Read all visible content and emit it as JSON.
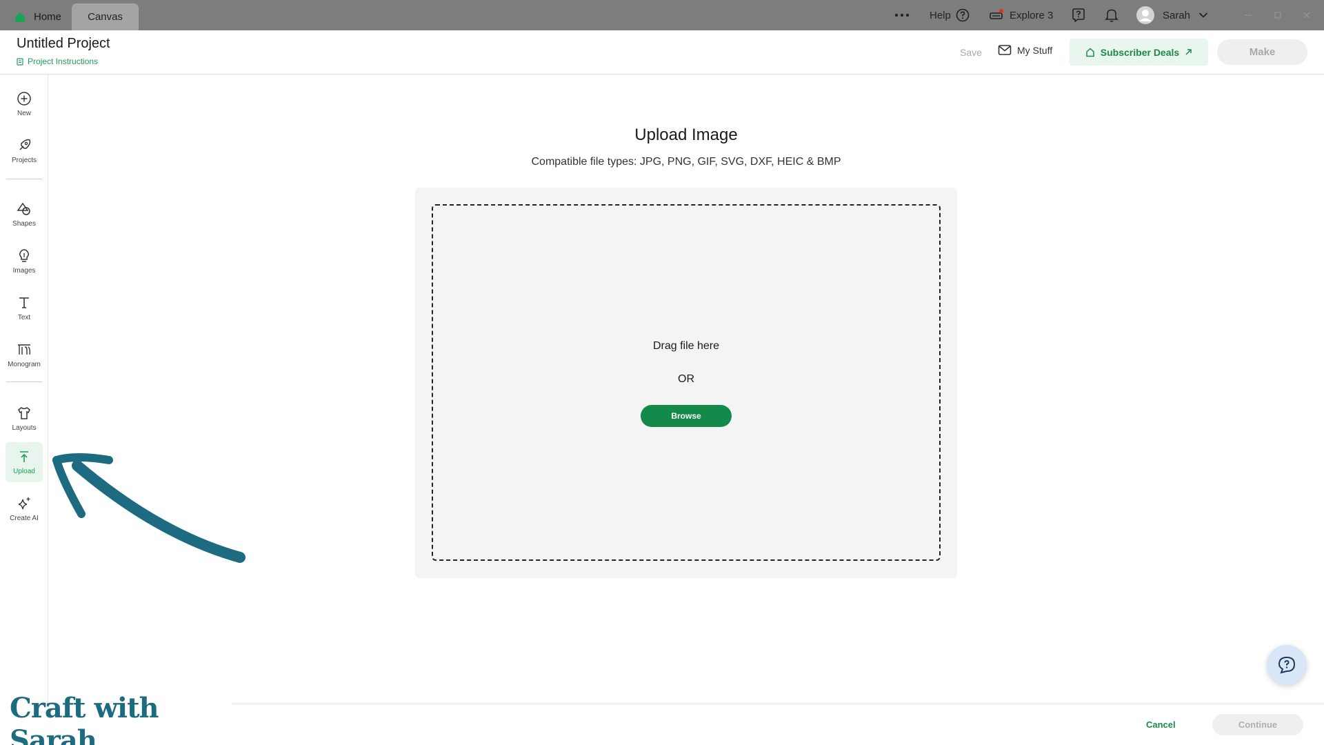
{
  "titlebar": {
    "tabs": [
      {
        "label": "Home"
      },
      {
        "label": "Canvas"
      }
    ],
    "help_label": "Help",
    "explore_label": "Explore 3",
    "user_name": "Sarah"
  },
  "header": {
    "project_title": "Untitled Project",
    "project_instructions": "Project Instructions",
    "save_label": "Save",
    "my_stuff_label": "My Stuff",
    "subscriber_deals_label": "Subscriber Deals",
    "make_label": "Make"
  },
  "sidebar": {
    "items": [
      {
        "label": "New",
        "icon": "plus-circle-icon"
      },
      {
        "label": "Projects",
        "icon": "projects-icon"
      },
      {
        "label": "Shapes",
        "icon": "shapes-icon"
      },
      {
        "label": "Images",
        "icon": "lightbulb-icon"
      },
      {
        "label": "Text",
        "icon": "text-icon"
      },
      {
        "label": "Monogram",
        "icon": "monogram-icon"
      },
      {
        "label": "Layouts",
        "icon": "tshirt-icon"
      },
      {
        "label": "Upload",
        "icon": "upload-icon"
      },
      {
        "label": "Create AI",
        "icon": "sparkle-icon"
      }
    ],
    "active": "Upload"
  },
  "main": {
    "title": "Upload Image",
    "subtitle": "Compatible file types:  JPG, PNG, GIF, SVG, DXF, HEIC & BMP",
    "drag_text": "Drag file here",
    "or_text": "OR",
    "browse_label": "Browse"
  },
  "footer": {
    "cancel_label": "Cancel",
    "continue_label": "Continue"
  },
  "watermark": {
    "text": "Craft with Sarah"
  },
  "colors": {
    "titlebar": "#7d7d7d",
    "brand_green": "#138a4a",
    "accent_green_light": "#e8f6ee",
    "arrow_teal": "#1d6b80"
  }
}
